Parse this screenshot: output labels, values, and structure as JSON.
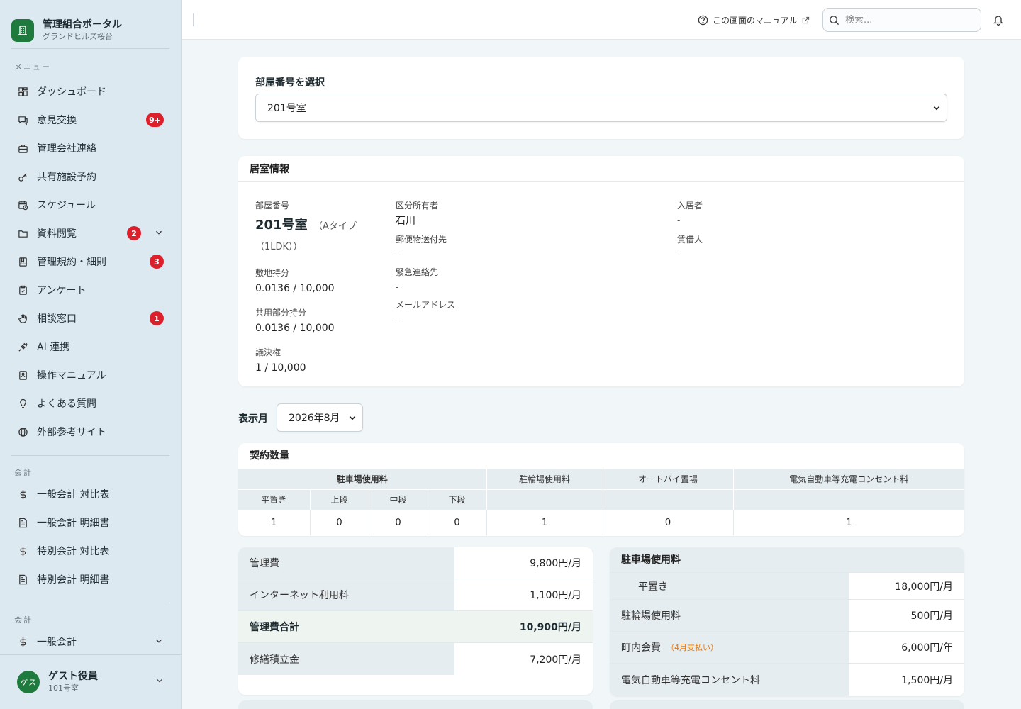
{
  "brand": {
    "title": "管理組合ポータル",
    "subtitle": "グランドヒルズ桜台"
  },
  "sidebar": {
    "menu_label": "メニュー",
    "items": [
      {
        "label": "ダッシュボード"
      },
      {
        "label": "意見交換",
        "badge": "9+"
      },
      {
        "label": "管理会社連絡"
      },
      {
        "label": "共有施設予約"
      },
      {
        "label": "スケジュール"
      },
      {
        "label": "資料閲覧",
        "badge": "2"
      },
      {
        "label": "管理規約・細則",
        "badge": "3"
      },
      {
        "label": "アンケート"
      },
      {
        "label": "相談窓口",
        "badge": "1"
      },
      {
        "label": "AI 連携"
      },
      {
        "label": "操作マニュアル"
      },
      {
        "label": "よくある質問"
      },
      {
        "label": "外部参考サイト"
      }
    ],
    "accounting_label": "会計",
    "accounting_items": [
      {
        "label": "一般会計 対比表"
      },
      {
        "label": "一般会計 明細書"
      },
      {
        "label": "特別会計 対比表"
      },
      {
        "label": "特別会計 明細書"
      }
    ],
    "accounting2_label": "会計",
    "accounting2_items": [
      {
        "label": "一般会計"
      }
    ]
  },
  "user": {
    "avatar": "ゲス",
    "name": "ゲスト役員",
    "room": "101号室"
  },
  "topbar": {
    "manual": "この画面のマニュアル",
    "search_placeholder": "検索..."
  },
  "room_select": {
    "label": "部屋番号を選択",
    "value": "201号室"
  },
  "room_info": {
    "title": "居室情報",
    "room_no_label": "部屋番号",
    "room_no": "201号室",
    "room_type": "（Aタイプ（1LDK））",
    "site_share_label": "敷地持分",
    "site_share": "0.0136 / 10,000",
    "common_share_label": "共用部分持分",
    "common_share": "0.0136 / 10,000",
    "vote_label": "議決権",
    "vote": "1 / 10,000",
    "owner_label": "区分所有者",
    "owner": "石川",
    "mail_label": "郵便物送付先",
    "mail": "-",
    "emergency_label": "緊急連絡先",
    "emergency": "-",
    "email_label": "メールアドレス",
    "email": "-",
    "resident_label": "入居者",
    "resident": "-",
    "tenant_label": "賃借人",
    "tenant": "-"
  },
  "month": {
    "label": "表示月",
    "value": "2026年8月"
  },
  "contract": {
    "title": "契約数量",
    "headers": {
      "parking": "駐車場使用料",
      "bicycle": "駐輪場使用料",
      "motorbike": "オートバイ置場",
      "ev": "電気自動車等充電コンセント料"
    },
    "subheaders": [
      "平置き",
      "上段",
      "中段",
      "下段"
    ],
    "values": [
      "1",
      "0",
      "0",
      "0",
      "1",
      "0",
      "1"
    ]
  },
  "fees_left": [
    {
      "name": "管理費",
      "value": "9,800円/月"
    },
    {
      "name": "インターネット利用料",
      "value": "1,100円/月"
    },
    {
      "name": "管理費合計",
      "value": "10,900円/月"
    },
    {
      "name": "修繕積立金",
      "value": "7,200円/月"
    }
  ],
  "fees_right": {
    "title": "駐車場使用料",
    "rows": [
      {
        "name": "平置き",
        "value": "18,000円/月"
      },
      {
        "name": "駐輪場使用料",
        "value": "500円/月"
      },
      {
        "name": "町内会費",
        "note": "（4月支払い）",
        "value": "6,000円/年"
      },
      {
        "name": "電気自動車等充電コンセント料",
        "value": "1,500円/月"
      }
    ]
  }
}
